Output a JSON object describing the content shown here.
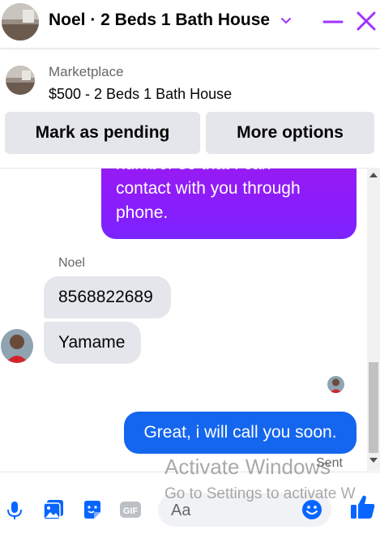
{
  "header": {
    "title": "Noel · 2 Beds 1 Bath House",
    "chevron_icon": "chevron-down-icon",
    "minimize_icon": "minimize-icon",
    "close_icon": "close-icon",
    "accent_color": "#a033ff"
  },
  "listing": {
    "source": "Marketplace",
    "title": "$500 - 2 Beds 1 Bath House"
  },
  "actions": {
    "pending_label": "Mark as pending",
    "more_label": "More options"
  },
  "messages": {
    "outgoing_top_lines": [
      "number so that I can",
      "contact with you through",
      "phone."
    ],
    "sender_name": "Noel",
    "incoming_1": "8568822689",
    "incoming_2": "Yamame",
    "outgoing_reply": "Great, i will call you soon.",
    "status": "Sent"
  },
  "composer": {
    "placeholder": "Aa",
    "tools": [
      "microphone-icon",
      "photo-icon",
      "sticker-icon",
      "gif-icon"
    ],
    "emoji_icon": "emoji-icon",
    "like_icon": "thumbs-up-icon"
  },
  "colors": {
    "purple_bubble": "#8a1dfb",
    "blue_bubble": "#1466ee",
    "incoming_bubble": "#e4e6eb"
  },
  "watermark": {
    "title": "Activate Windows",
    "subtitle": "Go to Settings to activate W"
  }
}
